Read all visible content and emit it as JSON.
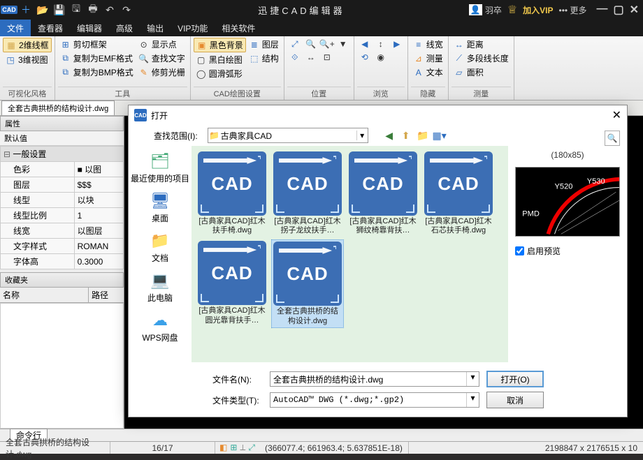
{
  "titlebar": {
    "app_short": "CAD",
    "title": "迅捷CAD编辑器",
    "username": "羽卒",
    "vip_label": "加入VIP",
    "more_label": "更多"
  },
  "menu": [
    "文件",
    "查看器",
    "编辑器",
    "高级",
    "输出",
    "VIP功能",
    "相关软件"
  ],
  "ribbon": {
    "groups": [
      {
        "label": "可视化风格",
        "cols": [
          [
            {
              "icon": "▦",
              "cls": "yellow",
              "text": "2维线框",
              "selected": true
            },
            {
              "icon": "◳",
              "cls": "blue",
              "text": "3维视图"
            }
          ]
        ]
      },
      {
        "label": "工具",
        "cols": [
          [
            {
              "icon": "⊞",
              "cls": "blue",
              "text": "剪切框架"
            },
            {
              "icon": "⧉",
              "cls": "blue",
              "text": "复制为EMF格式"
            },
            {
              "icon": "⧉",
              "cls": "blue",
              "text": "复制为BMP格式"
            }
          ],
          [
            {
              "icon": "⊙",
              "cls": "dark",
              "text": "显示点"
            },
            {
              "icon": "🔍",
              "cls": "dark",
              "text": "查找文字"
            },
            {
              "icon": "✎",
              "cls": "orange",
              "text": "修剪光栅"
            }
          ]
        ]
      },
      {
        "label": "CAD绘图设置",
        "cols": [
          [
            {
              "icon": "▣",
              "cls": "orange",
              "text": "黑色背景",
              "selected": true
            },
            {
              "icon": "▢",
              "cls": "dark",
              "text": "黑白绘图"
            },
            {
              "icon": "◯",
              "cls": "dark",
              "text": "圆滑弧形"
            }
          ],
          [
            {
              "icon": "≣",
              "cls": "blue",
              "text": "图层"
            },
            {
              "icon": "⬚",
              "cls": "blue",
              "text": "结构"
            }
          ]
        ]
      },
      {
        "label": "位置",
        "cols": [
          [
            {
              "icon": "⤢",
              "cls": "blue"
            },
            {
              "icon": "⟐",
              "cls": "blue"
            }
          ],
          [
            {
              "icon": "🔍",
              "cls": "dark"
            },
            {
              "icon": "↔",
              "cls": "dark"
            }
          ],
          [
            {
              "icon": "🔍+",
              "cls": "dark"
            },
            {
              "icon": "⊡",
              "cls": "dark"
            }
          ],
          [
            {
              "icon": "▼",
              "cls": "dark"
            }
          ]
        ]
      },
      {
        "label": "浏览",
        "cols": [
          [
            {
              "icon": "◀",
              "cls": "blue"
            },
            {
              "icon": "⟲",
              "cls": "blue"
            }
          ],
          [
            {
              "icon": "↕",
              "cls": "dark"
            },
            {
              "icon": "◉",
              "cls": "dark"
            }
          ],
          [
            {
              "icon": "▶",
              "cls": "blue"
            }
          ]
        ]
      },
      {
        "label": "隐藏",
        "cols": [
          [
            {
              "icon": "≡",
              "cls": "blue",
              "text": "线宽"
            },
            {
              "icon": "⊿",
              "cls": "orange",
              "text": "测量"
            },
            {
              "icon": "A",
              "cls": "blue",
              "text": "文本"
            }
          ]
        ]
      },
      {
        "label": "测量",
        "cols": [
          [
            {
              "icon": "↔",
              "cls": "blue",
              "text": "距离"
            },
            {
              "icon": "⟋",
              "cls": "blue",
              "text": "多段线长度"
            },
            {
              "icon": "▱",
              "cls": "blue",
              "text": "面积"
            }
          ]
        ]
      }
    ]
  },
  "doctab": "全套古典拱桥的结构设计.dwg",
  "props_panel": {
    "title": "属性",
    "subtitle": "默认值",
    "group": "一般设置",
    "rows": [
      [
        "色彩",
        "■ 以图"
      ],
      [
        "图层",
        "$$$"
      ],
      [
        "线型",
        "以块"
      ],
      [
        "线型比例",
        "1"
      ],
      [
        "线宽",
        "以图层"
      ],
      [
        "文字样式",
        "ROMAN"
      ],
      [
        "字体高",
        "0.3000"
      ]
    ]
  },
  "fav_panel": {
    "title": "收藏夹",
    "col1": "名称",
    "col2": "路径"
  },
  "open_dialog": {
    "title": "打开",
    "lookin_label": "查找范围(I):",
    "lookin_value": "古典家具CAD",
    "places": [
      {
        "icon": "🗂",
        "label": "最近使用的项目",
        "color": "#4a7"
      },
      {
        "icon": "🖥",
        "label": "桌面",
        "color": "#2c6cbf"
      },
      {
        "icon": "📁",
        "label": "文档",
        "color": "#d4a84e"
      },
      {
        "icon": "💻",
        "label": "此电脑",
        "color": "#2c6cbf"
      },
      {
        "icon": "☁",
        "label": "WPS网盘",
        "color": "#3aa0e8"
      }
    ],
    "files": [
      {
        "name": "[古典家具CAD]红木扶手椅.dwg"
      },
      {
        "name": "[古典家具CAD]红木拐子龙纹扶手…"
      },
      {
        "name": "[古典家具CAD]红木狮纹椅靠背扶…"
      },
      {
        "name": "[古典家具CAD]红木石芯扶手椅.dwg"
      },
      {
        "name": "[古典家具CAD]红木圆光靠背扶手…"
      },
      {
        "name": "全套古典拱桥的结构设计.dwg",
        "selected": true
      }
    ],
    "preview_dims": "(180x85)",
    "enable_preview": "启用预览",
    "filename_label": "文件名(N):",
    "filename_value": "全套古典拱桥的结构设计.dwg",
    "filetype_label": "文件类型(T):",
    "filetype_value": "AutoCAD™ DWG (*.dwg;*.gp2)",
    "open_btn": "打开(O)",
    "cancel_btn": "取消"
  },
  "cmdline_tab": "命令行",
  "status": {
    "file": "全套古典拱桥的结构设计.dwg",
    "pages": "16/17",
    "coords": "(366077.4; 661963.4; 5.637851E-18)",
    "dims": "2198847 x 2176515 x 10"
  }
}
